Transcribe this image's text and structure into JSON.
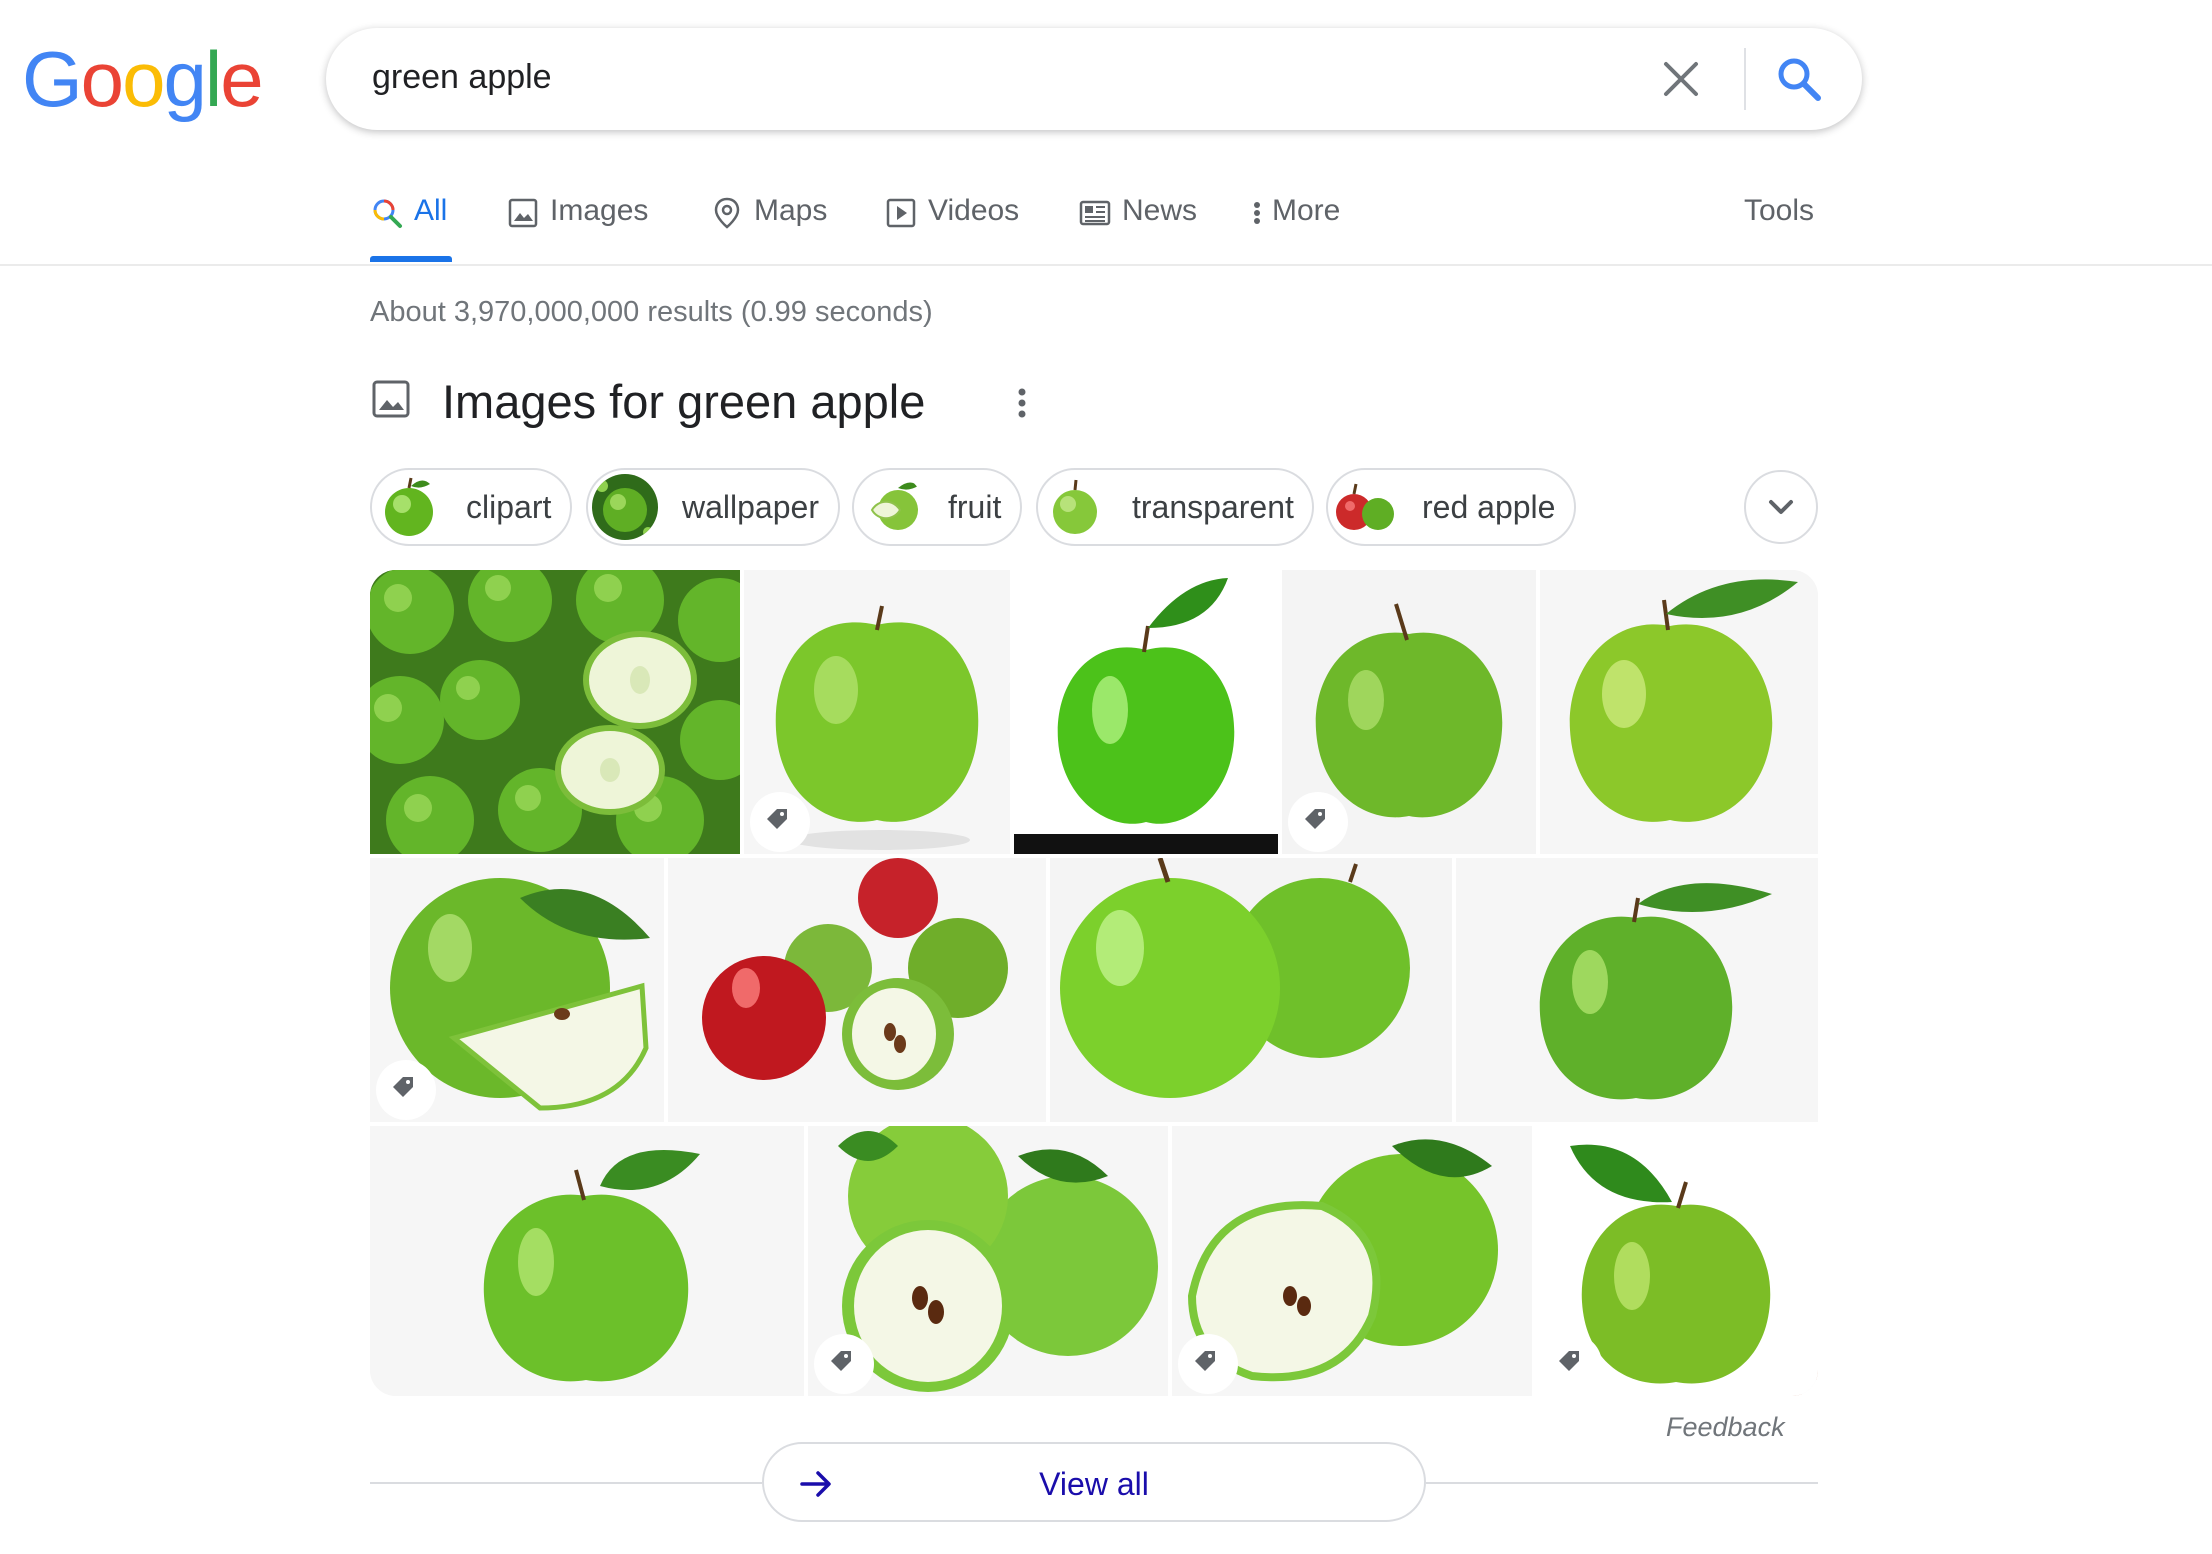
{
  "logo": {
    "letters": [
      "G",
      "o",
      "o",
      "g",
      "l",
      "e"
    ],
    "colors": [
      "#4285f4",
      "#ea4335",
      "#fbbc05",
      "#4285f4",
      "#34a853",
      "#ea4335"
    ]
  },
  "search": {
    "query": "green apple"
  },
  "tabs": [
    {
      "label": "All",
      "icon": "search-icon",
      "active": true
    },
    {
      "label": "Images",
      "icon": "image-icon"
    },
    {
      "label": "Maps",
      "icon": "map-pin-icon"
    },
    {
      "label": "Videos",
      "icon": "play-icon"
    },
    {
      "label": "News",
      "icon": "newspaper-icon"
    },
    {
      "label": "More",
      "icon": "more-vert-icon"
    }
  ],
  "tools_label": "Tools",
  "result_stats": "About 3,970,000,000 results (0.99 seconds)",
  "images_section": {
    "title": "Images for green apple",
    "chips": [
      {
        "label": "clipart"
      },
      {
        "label": "wallpaper"
      },
      {
        "label": "fruit"
      },
      {
        "label": "transparent"
      },
      {
        "label": "red apple"
      }
    ],
    "feedback_label": "Feedback",
    "view_all_label": "View all"
  },
  "colors": {
    "accent": "#1a73e8",
    "link": "#1a0dab",
    "apple_green": "#7cc72b",
    "apple_red": "#d32f2f"
  }
}
